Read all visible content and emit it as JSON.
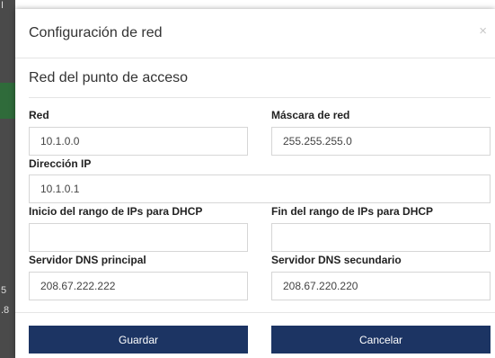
{
  "background": {
    "fragments": [
      "I",
      "5",
      ".8"
    ]
  },
  "dialog": {
    "title": "Configuración de red",
    "close_symbol": "×",
    "section_title": "Red del punto de acceso",
    "fields": {
      "network": {
        "label": "Red",
        "value": "10.1.0.0"
      },
      "netmask": {
        "label": "Máscara de red",
        "value": "255.255.255.0"
      },
      "ip": {
        "label": "Dirección IP",
        "value": "10.1.0.1"
      },
      "dhcp_start": {
        "label": "Inicio del rango de IPs para DHCP",
        "value": ""
      },
      "dhcp_end": {
        "label": "Fin del rango de IPs para DHCP",
        "value": ""
      },
      "dns_primary": {
        "label": "Servidor DNS principal",
        "value": "208.67.222.222"
      },
      "dns_secondary": {
        "label": "Servidor DNS secundario",
        "value": "208.67.220.220"
      }
    },
    "buttons": {
      "save": "Guardar",
      "cancel": "Cancelar"
    }
  },
  "colors": {
    "button_bg": "#1c3463",
    "button_text": "#ffffff"
  }
}
